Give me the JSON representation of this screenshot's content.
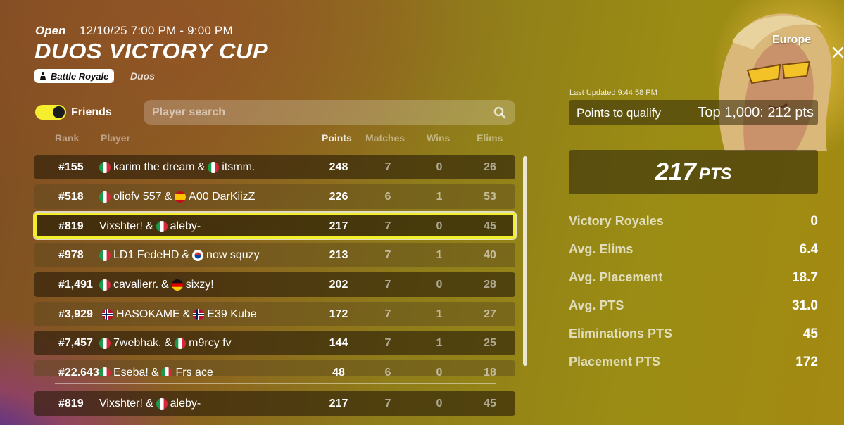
{
  "event": {
    "status": "Open",
    "datetime": "12/10/25 7:00 PM - 9:00 PM",
    "title": "DUOS VICTORY CUP",
    "mode": "Battle Royale",
    "team_size": "Duos",
    "region": "Europe"
  },
  "filters": {
    "friends_label": "Friends",
    "friends_toggle_on": true,
    "search_placeholder": "Player search"
  },
  "table": {
    "headers": {
      "rank": "Rank",
      "player": "Player",
      "points": "Points",
      "matches": "Matches",
      "wins": "Wins",
      "elims": "Elims"
    },
    "rows": [
      {
        "rank": "#155",
        "p1_flag": "italy-flag",
        "p1": "karim the dream",
        "sep": "&",
        "p2_flag": "italy-flag",
        "p2": "itsmm.",
        "points": "248",
        "matches": "7",
        "wins": "0",
        "elims": "26"
      },
      {
        "rank": "#518",
        "p1_flag": "italy-flag",
        "p1": "oliofv 557",
        "sep": "&",
        "p2_flag": "spain-flag",
        "p2": "A00 DarKiizZ",
        "points": "226",
        "matches": "6",
        "wins": "1",
        "elims": "53"
      },
      {
        "rank": "#819",
        "p1_flag": "",
        "p1": "Vixshter!",
        "sep": "&",
        "p2_flag": "italy-flag",
        "p2": "aleby-",
        "points": "217",
        "matches": "7",
        "wins": "0",
        "elims": "45"
      },
      {
        "rank": "#978",
        "p1_flag": "italy-flag",
        "p1": "LD1 FedeHD",
        "sep": "&",
        "p2_flag": "korea-flag",
        "p2": "now squzy",
        "points": "213",
        "matches": "7",
        "wins": "1",
        "elims": "40"
      },
      {
        "rank": "#1,491",
        "p1_flag": "italy-flag",
        "p1": "cavalierr.",
        "sep": "&",
        "p2_flag": "germany-flag",
        "p2": "sixzy!",
        "points": "202",
        "matches": "7",
        "wins": "0",
        "elims": "28"
      },
      {
        "rank": "#3,929",
        "p1_flag": "norway-flag",
        "p1": "HASOKAME",
        "sep": "&",
        "p2_flag": "norway-flag",
        "p2": "E39 Kube",
        "points": "172",
        "matches": "7",
        "wins": "1",
        "elims": "27"
      },
      {
        "rank": "#7,457",
        "p1_flag": "italy-flag",
        "p1": "7webhak.",
        "sep": "&",
        "p2_flag": "italy-flag",
        "p2": "m9rcy fv",
        "points": "144",
        "matches": "7",
        "wins": "1",
        "elims": "25"
      },
      {
        "rank": "#22,643",
        "p1_flag": "italy-flag",
        "p1": "Eseba!",
        "sep": "&",
        "p2_flag": "italy-flag",
        "p2": "Frs ace",
        "points": "48",
        "matches": "6",
        "wins": "0",
        "elims": "18"
      }
    ],
    "pinned": {
      "rank": "#819",
      "p1": "Vixshter!",
      "sep": "&",
      "p2_flag": "italy-flag",
      "p2": "aleby-",
      "points": "217",
      "matches": "7",
      "wins": "0",
      "elims": "45"
    }
  },
  "summary": {
    "last_updated": "Last Updated 9:44:58 PM",
    "qualify_label": "Points to qualify",
    "qualify_value": "Top 1,000: 212 pts",
    "total_points": "217",
    "total_unit": "PTS",
    "stats": [
      {
        "label": "Victory Royales",
        "value": "0"
      },
      {
        "label": "Avg. Elims",
        "value": "6.4"
      },
      {
        "label": "Avg. Placement",
        "value": "18.7"
      },
      {
        "label": "Avg. PTS",
        "value": "31.0"
      },
      {
        "label": "Eliminations PTS",
        "value": "45"
      },
      {
        "label": "Placement PTS",
        "value": "172"
      }
    ]
  },
  "colors": {
    "highlight": "#f1ee2a",
    "toggle": "#f4ee2e"
  }
}
